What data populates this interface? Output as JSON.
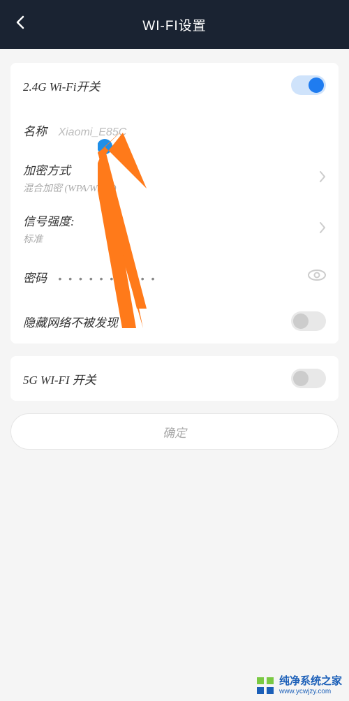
{
  "header": {
    "title": "WI-FI设置"
  },
  "wifi24": {
    "switchLabel": "2.4G Wi-Fi开关",
    "switchOn": true,
    "nameLabel": "名称",
    "nameValue": "Xiaomi_E85C",
    "encryptLabel": "加密方式",
    "encryptValue": "混合加密 (WPA/WPA2)",
    "signalLabel": "信号强度:",
    "signalValue": "标准",
    "passwordLabel": "密码",
    "passwordMask": "• • • • • • • • • •",
    "hideLabel": "隐藏网络不被发现",
    "hideOn": false
  },
  "wifi5": {
    "switchLabel": "5G WI-FI 开关",
    "switchOn": false
  },
  "confirm": {
    "label": "确定"
  },
  "watermark": {
    "title": "纯净系统之家",
    "url": "www.ycwjzy.com"
  }
}
